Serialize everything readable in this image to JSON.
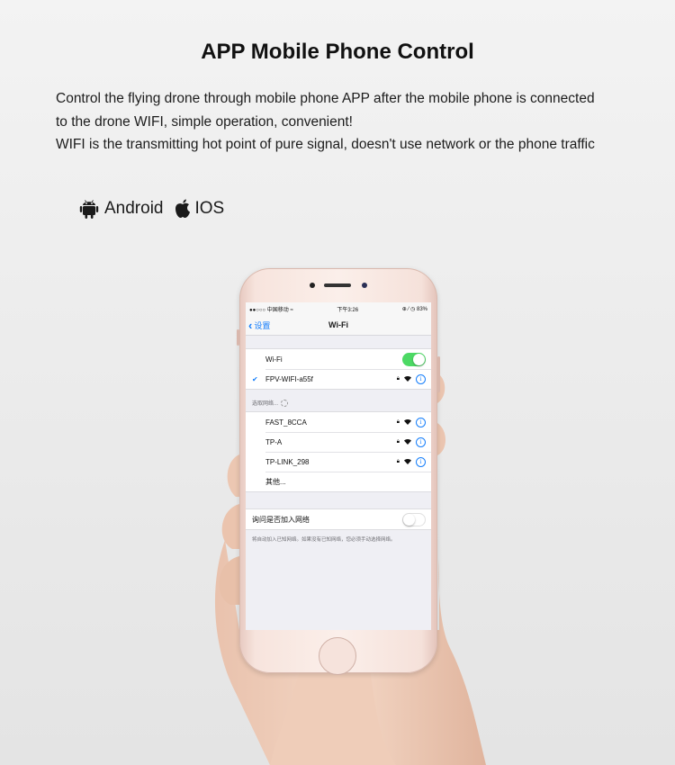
{
  "header": {
    "title": "APP Mobile Phone Control",
    "description_lines": [
      "Control the flying drone through mobile phone APP after the mobile phone is connected",
      "to the drone WIFI, simple operation, convenient!",
      "WIFI is the transmitting hot point of pure signal, doesn't use network or the phone traffic"
    ]
  },
  "platforms": {
    "android": {
      "label": "Android",
      "icon": "android-icon"
    },
    "ios": {
      "label": "IOS",
      "icon": "apple-icon"
    }
  },
  "phone": {
    "status_bar": {
      "carrier": "●●○○○ 中国移动 ≈",
      "time": "下午3:26",
      "battery": "⊕ ⁄ ◷ 83%"
    },
    "nav": {
      "back_label": "设置",
      "title": "Wi-Fi"
    },
    "wifi_toggle": {
      "label": "Wi-Fi",
      "on": true
    },
    "connected_network": {
      "name": "FPV-WIFI-a55f",
      "checked": true
    },
    "choose_header": "选取网络...",
    "networks": [
      {
        "name": "FAST_8CCA",
        "locked": true
      },
      {
        "name": "TP-A",
        "locked": true
      },
      {
        "name": "TP-LINK_298",
        "locked": true
      }
    ],
    "other_label": "其他...",
    "ask_to_join": {
      "label": "询问是否加入网络",
      "on": false
    },
    "footnote": "将自动加入已知网络。如果没有已知网络，您必须手动选择网络。"
  },
  "colors": {
    "ios_blue": "#157efb",
    "toggle_green": "#4cd964",
    "phone_rose_gold": "#f3ddd5"
  }
}
